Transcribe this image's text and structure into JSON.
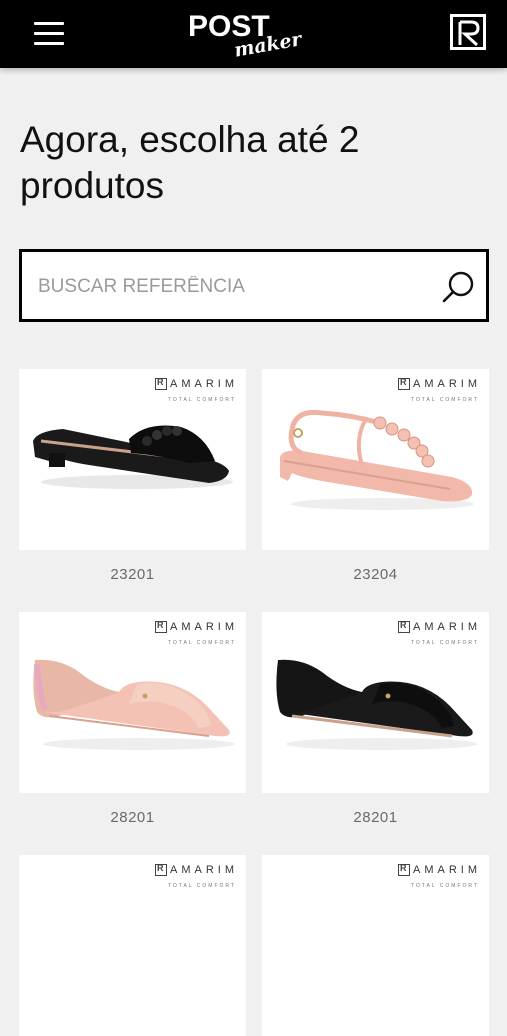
{
  "header": {
    "logo_top": "POST",
    "logo_bottom": "maker",
    "menu_icon": "hamburger-icon",
    "brand_icon": "ramarim-r-icon"
  },
  "page": {
    "title": "Agora, escolha até 2 produtos"
  },
  "search": {
    "placeholder": "BUSCAR REFERÊNCIA",
    "value": "",
    "icon": "search-icon"
  },
  "products": [
    {
      "code": "23201",
      "brand": "AMARIM",
      "tagline": "TOTAL COMFORT",
      "color": "#111111",
      "style": "slide"
    },
    {
      "code": "23204",
      "brand": "AMARIM",
      "tagline": "TOTAL COMFORT",
      "color": "#f2b8aa",
      "style": "sandal"
    },
    {
      "code": "28201",
      "brand": "AMARIM",
      "tagline": "TOTAL COMFORT",
      "color": "#f4c2b4",
      "style": "open-flat"
    },
    {
      "code": "28201",
      "brand": "AMARIM",
      "tagline": "TOTAL COMFORT",
      "color": "#111111",
      "style": "open-flat"
    },
    {
      "code": "",
      "brand": "AMARIM",
      "tagline": "TOTAL COMFORT"
    },
    {
      "code": "",
      "brand": "AMARIM",
      "tagline": "TOTAL COMFORT"
    }
  ]
}
